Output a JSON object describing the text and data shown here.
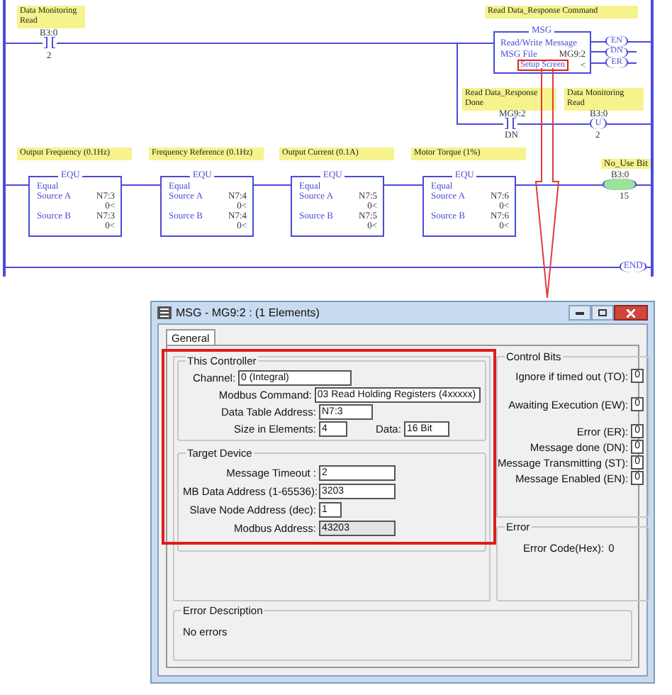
{
  "ladder": {
    "rung_0": {
      "contact": {
        "label": "Data Monitoring Read",
        "address": "B3:0",
        "bit": "2"
      },
      "msg": {
        "label": "Read Data_Response Command",
        "title": "MSG",
        "line_1": "Read/Write Message",
        "file_label": "MSG File",
        "file": "MG9:2",
        "button": "Setup Screen",
        "marker": "<"
      },
      "coils": [
        {
          "text": "EN"
        },
        {
          "text": "DN"
        },
        {
          "text": "ER"
        }
      ],
      "branch_contact": {
        "label": "Read Data_Response Done",
        "address": "MG9:2",
        "bit": "DN"
      },
      "branch_coil": {
        "label": "Data Monitoring Read",
        "address": "B3:0",
        "text": "U",
        "bit": "2"
      }
    },
    "rung_1": {
      "blocks": [
        {
          "label": "Output Frequency (0.1Hz)",
          "title": "EQU",
          "name": "Equal",
          "a_label": "Source A",
          "a_addr": "N7:3",
          "a_val": "0<",
          "b_label": "Source B",
          "b_addr": "N7:3",
          "b_val": "0<"
        },
        {
          "label": "Frequency Reference (0.1Hz)",
          "title": "EQU",
          "name": "Equal",
          "a_label": "Source A",
          "a_addr": "N7:4",
          "a_val": "0<",
          "b_label": "Source B",
          "b_addr": "N7:4",
          "b_val": "0<"
        },
        {
          "label": "Output Current (0.1A)",
          "title": "EQU",
          "name": "Equal",
          "a_label": "Source A",
          "a_addr": "N7:5",
          "a_val": "0<",
          "b_label": "Source B",
          "b_addr": "N7:5",
          "b_val": "0<"
        },
        {
          "label": "Motor Torque (1%)",
          "title": "EQU",
          "name": "Equal",
          "a_label": "Source A",
          "a_addr": "N7:6",
          "a_val": "0<",
          "b_label": "Source B",
          "b_addr": "N7:6",
          "b_val": "0<"
        }
      ],
      "coil": {
        "label": "No_Use Bit",
        "address": "B3:0",
        "bit": "15",
        "energized": true
      }
    },
    "end": "END"
  },
  "dialog": {
    "title": "MSG - MG9:2 : (1 Elements)",
    "tabs": [
      {
        "label": "General",
        "selected": true
      }
    ],
    "this_controller": {
      "title": "This Controller",
      "channel": {
        "label": "Channel:",
        "value": "0 (Integral)"
      },
      "fields": [
        {
          "label": "Modbus Command:",
          "value": "03 Read Holding Registers (4xxxxx)"
        },
        {
          "label": "Data Table Address:",
          "value": "N7:3"
        },
        {
          "label": "Size in Elements:",
          "value": "4"
        }
      ],
      "data": {
        "label": "Data:",
        "value": "16 Bit"
      }
    },
    "target_device": {
      "title": "Target Device",
      "fields": [
        {
          "label": "Message Timeout :",
          "value": "2",
          "disabled": false
        },
        {
          "label": "MB Data Address (1-65536):",
          "value": "3203",
          "disabled": false
        },
        {
          "label": "Slave Node Address (dec):",
          "value": "1",
          "disabled": false
        },
        {
          "label": "Modbus Address:",
          "value": "43203",
          "disabled": true
        }
      ]
    },
    "control_bits": {
      "title": "Control Bits",
      "items": [
        {
          "label": "Ignore if timed out (TO):",
          "value": "0"
        },
        {
          "label": "Awaiting Execution (EW):",
          "value": "0"
        },
        {
          "label": "Error (ER):",
          "value": "0"
        },
        {
          "label": "Message done (DN):",
          "value": "0"
        },
        {
          "label": "Message Transmitting (ST):",
          "value": "0"
        },
        {
          "label": "Message Enabled (EN):",
          "value": "0"
        }
      ]
    },
    "error": {
      "title": "Error",
      "label": "Error Code(Hex):",
      "value": "0"
    },
    "error_description": {
      "title": "Error Description",
      "text": "No errors"
    }
  }
}
